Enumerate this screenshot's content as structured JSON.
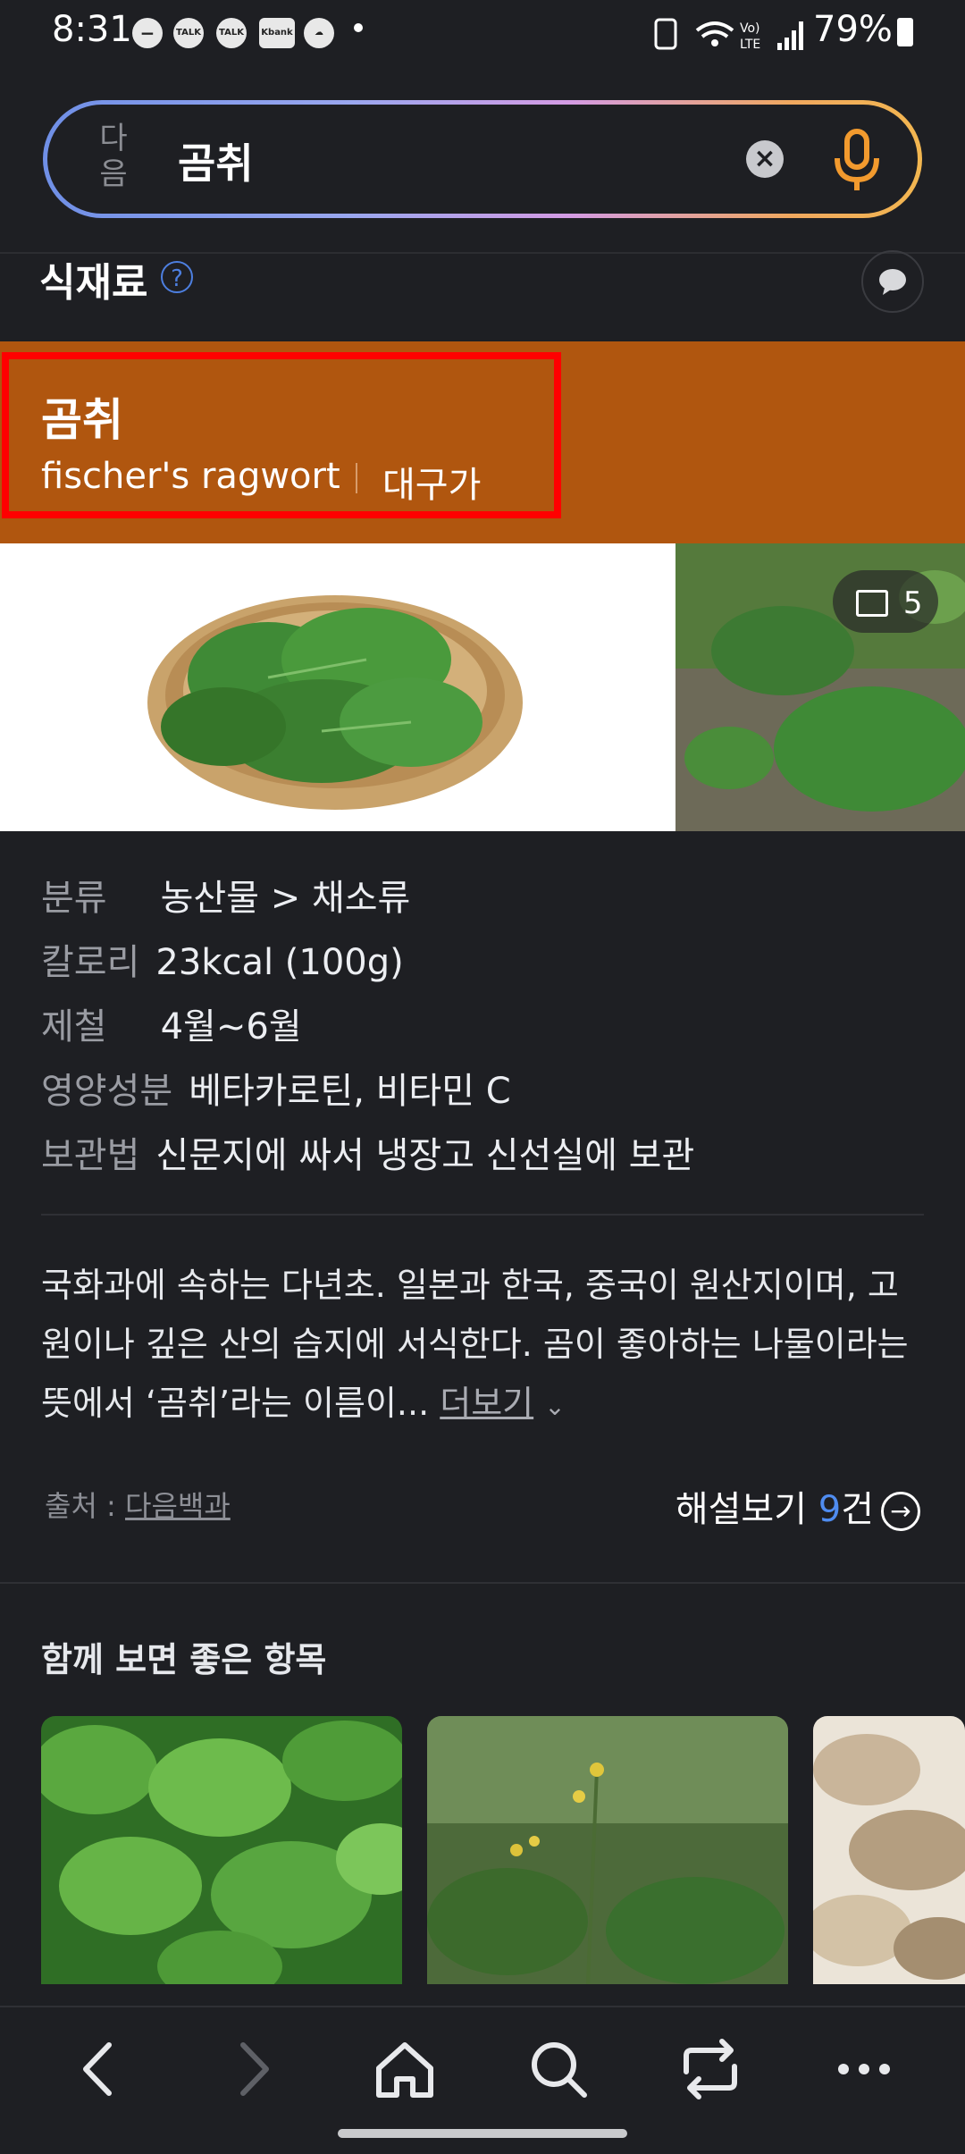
{
  "status_bar": {
    "time": "8:31",
    "battery": "79%",
    "notifications": [
      "TALK",
      "TALK",
      "Kbank"
    ]
  },
  "search": {
    "logo_text": "다음",
    "query": "곰취",
    "clear_icon": "clear-icon",
    "mic_icon": "mic-icon"
  },
  "section": {
    "title": "식재료",
    "help": "?"
  },
  "header": {
    "korean_name": "곰취",
    "english_name": "fischer's ragwort",
    "alt_name": "대구가",
    "band_color": "#b0560f"
  },
  "gallery": {
    "image_count": "5"
  },
  "info": [
    {
      "label": "분류",
      "value": "농산물 > 채소류"
    },
    {
      "label": "칼로리",
      "value": "23kcal (100g)"
    },
    {
      "label": "제철",
      "value": "4월~6월"
    },
    {
      "label": "영양성분",
      "value": "베타카로틴, 비타민 C"
    },
    {
      "label": "보관법",
      "value": "신문지에 싸서 냉장고 신선실에 보관"
    }
  ],
  "description": {
    "text": "국화과에 속하는 다년초. 일본과 한국, 중국이 원산지이며, 고원이나 깊은 산의 습지에 서식한다. 곰이 좋아하는 나물이라는 뜻에서 ‘곰취’라는 이름이...",
    "more": "더보기"
  },
  "source": {
    "label": "출처 : ",
    "name": "다음백과"
  },
  "explain": {
    "label": "해설보기 ",
    "count": "9",
    "unit": "건"
  },
  "related": {
    "title": "함께 보면 좋은 항목"
  },
  "colors": {
    "background": "#1e1f23",
    "accent": "#4f8cf0",
    "highlight": "#ff0000"
  }
}
